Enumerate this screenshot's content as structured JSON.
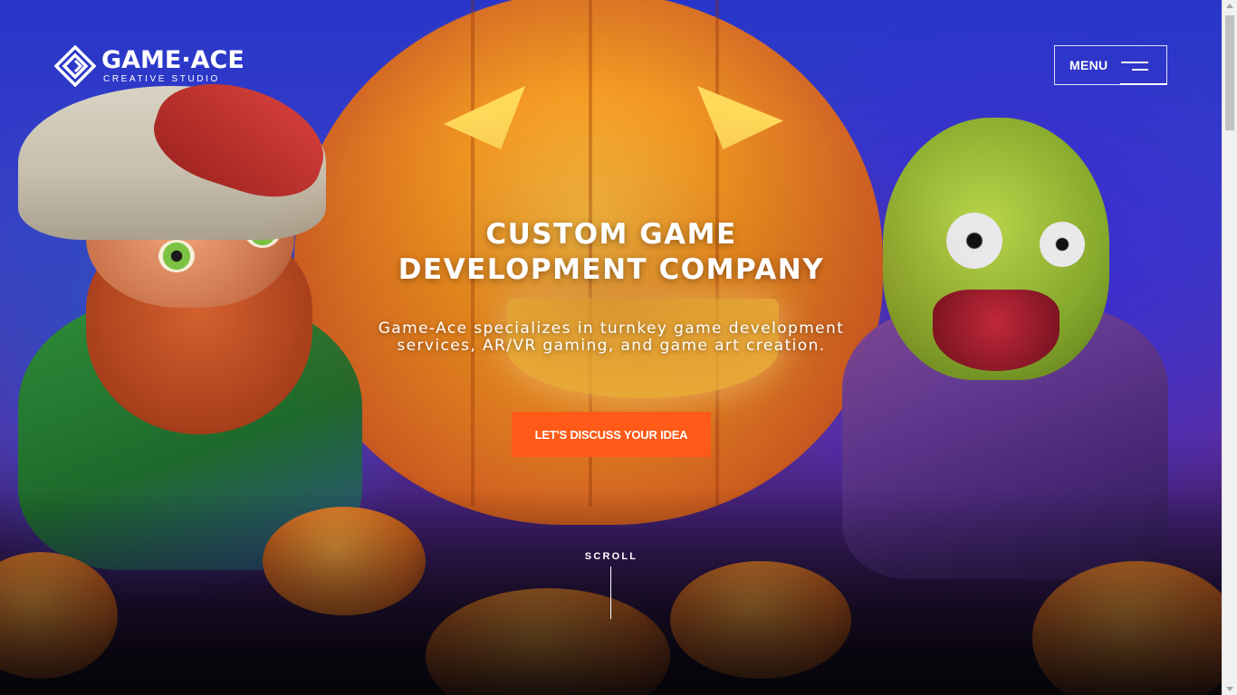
{
  "logo": {
    "name": "GAME·ACE",
    "sub": "CREATIVE STUDIO"
  },
  "menu": {
    "label": "MENU",
    "icon": "hamburger-icon"
  },
  "hero": {
    "title_line1": "CUSTOM GAME",
    "title_line2": "DEVELOPMENT COMPANY",
    "subtitle_line1": "Game-Ace specializes in turnkey game development",
    "subtitle_line2": "services, AR/VR gaming, and game art creation.",
    "cta_label": "LET'S DISCUSS YOUR IDEA"
  },
  "scroll_hint": {
    "label": "SCROLL"
  },
  "colors": {
    "accent": "#ff5a17",
    "text": "#ffffff"
  }
}
